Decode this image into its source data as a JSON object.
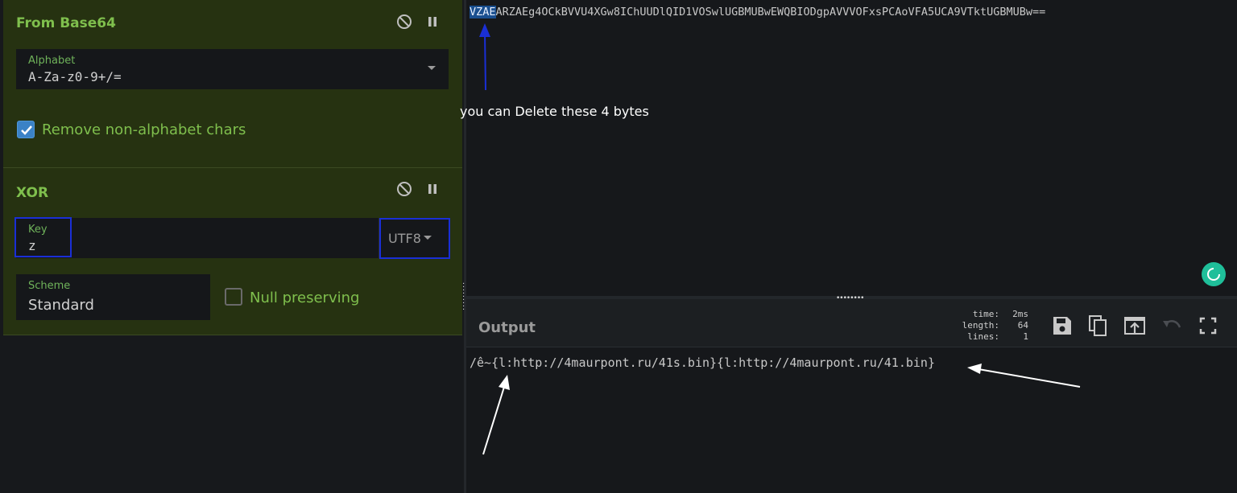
{
  "recipe": {
    "from_base64": {
      "title": "From Base64",
      "alphabet_label": "Alphabet",
      "alphabet_value": "A-Za-z0-9+/=",
      "remove_nonalpha_label": "Remove non-alphabet chars",
      "remove_nonalpha_checked": true
    },
    "xor": {
      "title": "XOR",
      "key_label": "Key",
      "key_value": "z",
      "key_format": "UTF8",
      "scheme_label": "Scheme",
      "scheme_value": "Standard",
      "null_preserving_label": "Null preserving",
      "null_preserving_checked": false
    }
  },
  "input": {
    "selected_text": "VZAE",
    "rest_text": "ARZAEg4OCkBVVU4XGw8IChUUDlQID1VOSwlUGBMUBwEWQBIODgpAVVVOFxsPCAoVFA5UCA9VTktUGBMUBw=="
  },
  "annotation": {
    "text": "you can Delete these 4 bytes",
    "arrow_color": "#1a2fd6"
  },
  "output": {
    "title": "Output",
    "stats": [
      {
        "key": "time:",
        "value": "2ms"
      },
      {
        "key": "length:",
        "value": "64"
      },
      {
        "key": "lines:",
        "value": "1"
      }
    ],
    "text": "/ê~{l:http://4maurpont.ru/41s.bin}{l:http://4maurpont.ru/41.bin}",
    "buttons": [
      "save-icon",
      "copy-icon",
      "replace-input-icon",
      "undo-icon",
      "maximise-icon"
    ]
  },
  "colors": {
    "recipe_bg": "#263211",
    "label_green": "#7fbf4d",
    "selection": "#1a4f8f",
    "highlight_box": "#1a2fd6",
    "status_ok": "#1fbf9a"
  }
}
